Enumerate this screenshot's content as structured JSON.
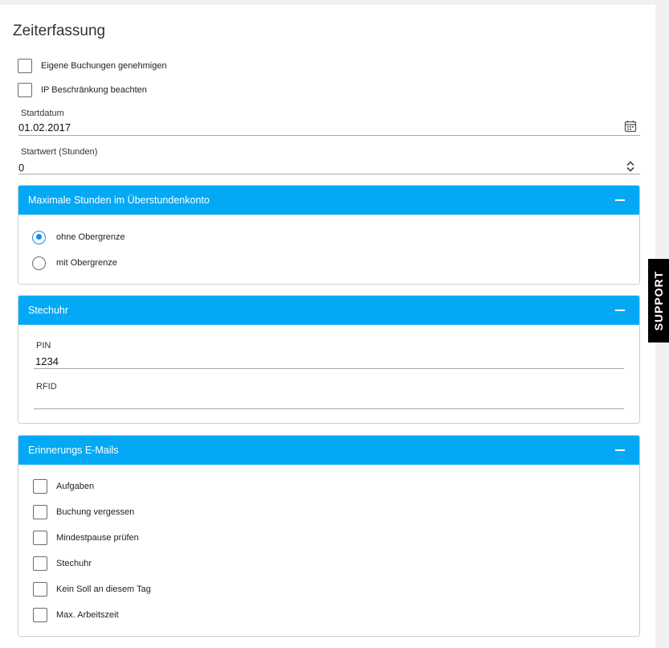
{
  "page": {
    "title": "Zeiterfassung"
  },
  "general": {
    "checkboxes": [
      {
        "label": "Eigene Buchungen genehmigen",
        "checked": false
      },
      {
        "label": "IP Beschränkung beachten",
        "checked": false
      }
    ],
    "startdatum": {
      "label": "Startdatum",
      "value": "01.02.2017",
      "icon": "calendar-icon"
    },
    "startwert": {
      "label": "Startwert (Stunden)",
      "value": "0",
      "icon": "spinner-arrows-icon"
    }
  },
  "panels": {
    "ueberstunden": {
      "title": "Maximale Stunden im Überstundenkonto",
      "options": [
        {
          "label": "ohne Obergrenze",
          "selected": true
        },
        {
          "label": "mit Obergrenze",
          "selected": false
        }
      ]
    },
    "stechuhr": {
      "title": "Stechuhr",
      "pin": {
        "label": "PIN",
        "value": "1234"
      },
      "rfid": {
        "label": "RFID",
        "value": ""
      }
    },
    "erinnerungen": {
      "title": "Erinnerungs E-Mails",
      "items": [
        {
          "label": "Aufgaben",
          "checked": false
        },
        {
          "label": "Buchung vergessen",
          "checked": false
        },
        {
          "label": "Mindestpause prüfen",
          "checked": false
        },
        {
          "label": "Stechuhr",
          "checked": false
        },
        {
          "label": "Kein Soll an diesem Tag",
          "checked": false
        },
        {
          "label": "Max. Arbeitszeit",
          "checked": false
        }
      ]
    }
  },
  "support": {
    "label": "SUPPORT"
  },
  "colors": {
    "accent": "#03a9f4",
    "radio_selected": "#1e88e5",
    "support_bg": "#000000"
  }
}
